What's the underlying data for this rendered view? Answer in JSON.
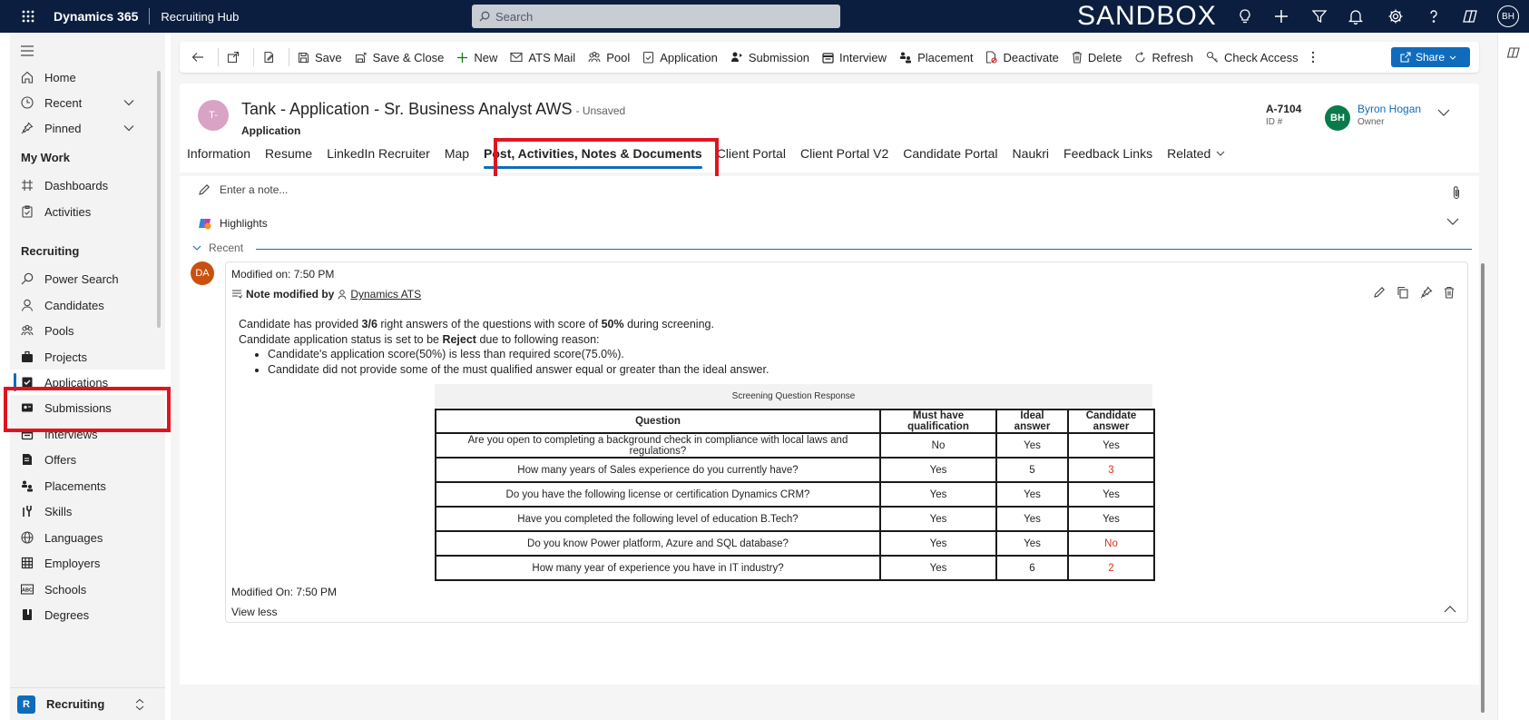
{
  "topbar": {
    "brand": "Dynamics 365",
    "hub": "Recruiting Hub",
    "search_placeholder": "Search",
    "environment": "SANDBOX",
    "user_initials": "BH"
  },
  "nav": {
    "home": "Home",
    "recent": "Recent",
    "pinned": "Pinned",
    "my_work": "My Work",
    "dashboards": "Dashboards",
    "activities": "Activities",
    "recruiting": "Recruiting",
    "items": [
      "Power Search",
      "Candidates",
      "Pools",
      "Projects",
      "Applications",
      "Submissions",
      "Interviews",
      "Offers",
      "Placements",
      "Skills",
      "Languages",
      "Employers",
      "Schools",
      "Degrees"
    ],
    "area_badge": "R",
    "area": "Recruiting"
  },
  "commands": {
    "save": "Save",
    "save_close": "Save & Close",
    "new": "New",
    "ats_mail": "ATS Mail",
    "pool": "Pool",
    "application": "Application",
    "submission": "Submission",
    "interview": "Interview",
    "placement": "Placement",
    "deactivate": "Deactivate",
    "delete": "Delete",
    "refresh": "Refresh",
    "check_access": "Check Access",
    "share": "Share"
  },
  "record": {
    "initials": "T-",
    "title": "Tank - Application - Sr. Business Analyst AWS",
    "unsaved": "- Unsaved",
    "type": "Application",
    "id_value": "A-7104",
    "id_label": "ID #",
    "owner_initials": "BH",
    "owner_name": "Byron Hogan",
    "owner_label": "Owner"
  },
  "tabs": [
    "Information",
    "Resume",
    "LinkedIn Recruiter",
    "Map",
    "Post, Activities, Notes & Documents",
    "Client Portal",
    "Client Portal V2",
    "Candidate Portal",
    "Naukri",
    "Feedback Links",
    "Related"
  ],
  "timeline": {
    "note_placeholder": "Enter a note...",
    "highlights": "Highlights",
    "recent": "Recent",
    "post": {
      "avatar": "DA",
      "modified_top": "Modified on: 7:50 PM",
      "note_modified_by": "Note modified by",
      "author": "Dynamics ATS",
      "line1_a": "Candidate has provided ",
      "line1_b": "3/6",
      "line1_c": " right answers of the questions with score of ",
      "line1_d": "50%",
      "line1_e": " during screening.",
      "line2_a": "Candidate application status is set to be ",
      "line2_b": "Reject",
      "line2_c": " due to following reason:",
      "bullet1": "Candidate's application score(50%) is less than required score(75.0%).",
      "bullet2": "Candidate did not provide some of the must qualified answer equal or greater than the ideal answer.",
      "table_title": "Screening Question Response",
      "table_headers": [
        "Question",
        "Must have qualification",
        "Ideal answer",
        "Candidate answer"
      ],
      "table_rows": [
        [
          "Are you open to completing a background check in compliance with local laws and regulations?",
          "No",
          "Yes",
          "Yes"
        ],
        [
          "How many years of Sales experience do you currently have?",
          "Yes",
          "5",
          "3"
        ],
        [
          "Do you have the following license or certification Dynamics CRM?",
          "Yes",
          "Yes",
          "Yes"
        ],
        [
          "Have you completed the following level of education B.Tech?",
          "Yes",
          "Yes",
          "Yes"
        ],
        [
          "Do you know Power platform, Azure and SQL database?",
          "Yes",
          "Yes",
          "No"
        ],
        [
          "How many year of experience you have in IT industry?",
          "Yes",
          "6",
          "2"
        ]
      ],
      "modified_bottom": "Modified On: 7:50 PM",
      "view_less": "View less"
    }
  },
  "colors": {
    "accent": "#0f6cbd",
    "topbar": "#0b1e3f",
    "highlight_box": "#e0141e",
    "bad_answer": "#e0301e"
  }
}
